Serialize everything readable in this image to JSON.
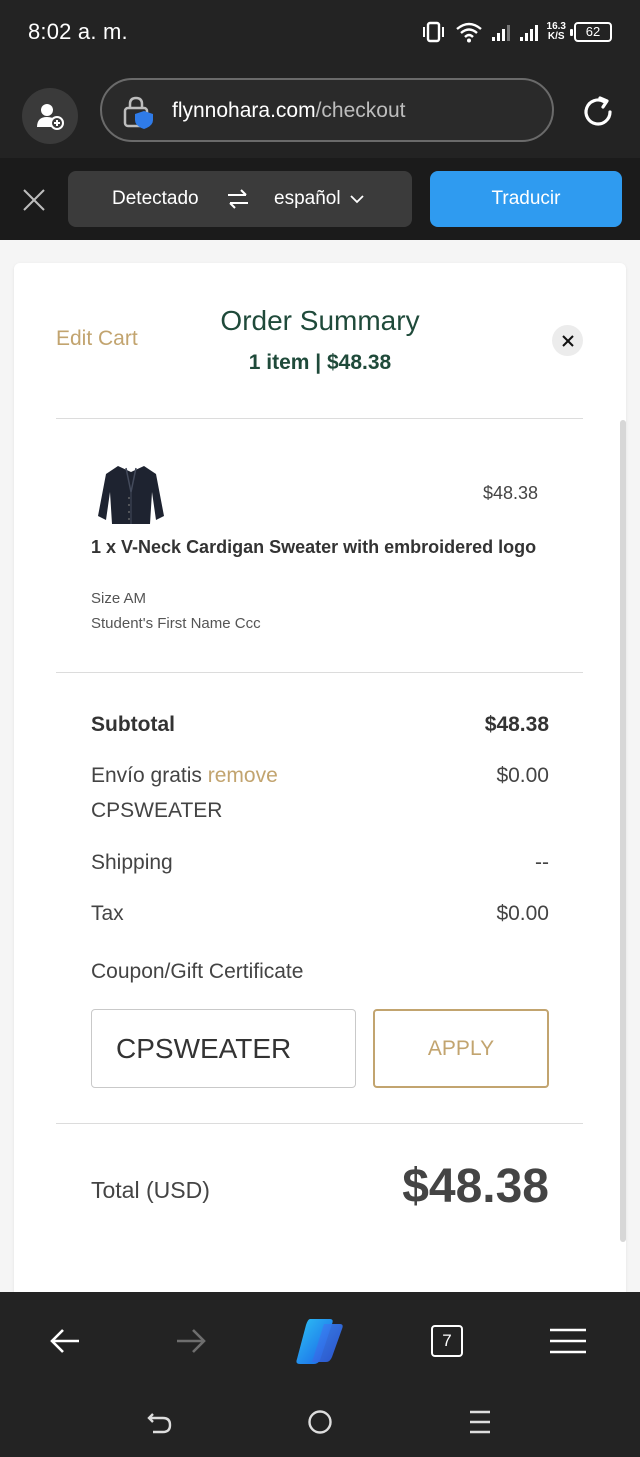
{
  "status_bar": {
    "time": "8:02 a. m.",
    "net_speed_value": "16.3",
    "net_speed_unit": "K/S",
    "battery": "62"
  },
  "browser": {
    "url_domain": "flynnohara.com",
    "url_path": "/checkout",
    "translate": {
      "detected": "Detectado",
      "target": "español",
      "button": "Traducir"
    },
    "tabs_count": "7"
  },
  "order_summary": {
    "edit_cart": "Edit Cart",
    "title": "Order Summary",
    "subtitle": "1 item | $48.38",
    "item": {
      "price": "$48.38",
      "name": "1 x V-Neck Cardigan Sweater with embroidered logo",
      "size": "Size AM",
      "personalization": "Student's First Name Ccc"
    },
    "subtotal_label": "Subtotal",
    "subtotal_value": "$48.38",
    "discount_label": "Envío gratis",
    "discount_remove": "remove",
    "discount_code": "CPSWEATER",
    "discount_value": "$0.00",
    "shipping_label": "Shipping",
    "shipping_value": "--",
    "tax_label": "Tax",
    "tax_value": "$0.00",
    "coupon_label": "Coupon/Gift Certificate",
    "coupon_value": "CPSWEATER",
    "apply_label": "APPLY",
    "total_label": "Total (USD)",
    "total_value": "$48.38"
  },
  "colors": {
    "accent_gold": "#c2a46f",
    "heading_green": "#1f4a3a",
    "translate_blue": "#2f9bf0"
  }
}
